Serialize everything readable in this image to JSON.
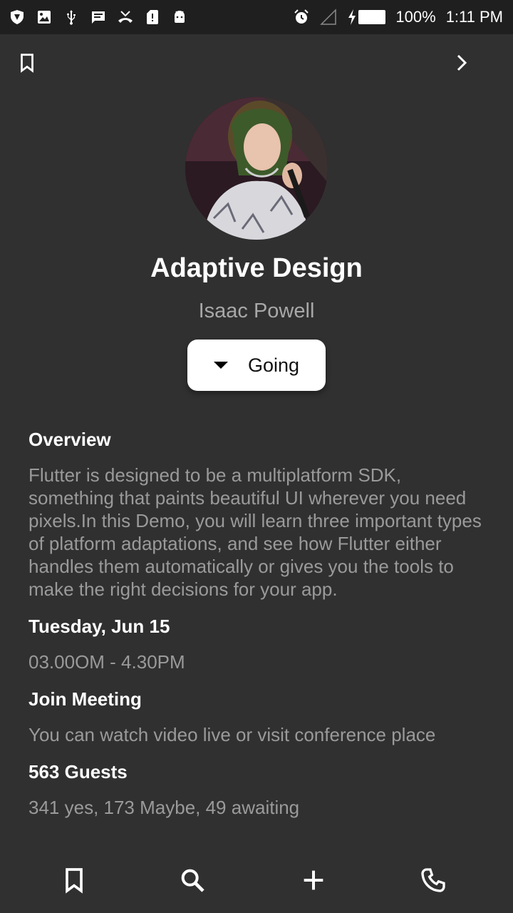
{
  "status_bar": {
    "left_icons": [
      "shield-icon",
      "image-icon",
      "usb-icon",
      "message-icon",
      "missed-call-icon",
      "sim-alert-icon",
      "android-icon"
    ],
    "right_icons": [
      "alarm-icon",
      "signal-icon",
      "charging-icon",
      "battery-icon"
    ],
    "battery": "100%",
    "time": "1:11 PM"
  },
  "app_bar": {
    "left_icon": "bookmark-outline-icon",
    "right_icon": "chevron-right-icon"
  },
  "event": {
    "title": "Adaptive Design",
    "speaker": "Isaac Powell",
    "rsvp_label": "Going",
    "overview_heading": "Overview",
    "overview_text": "Flutter is designed to be a multiplatform SDK, something that paints beautiful UI wherever you need pixels.In this Demo, you will learn three important types of platform adaptations, and see how Flutter either handles them automatically or gives you the tools to make the right decisions for your app.",
    "date_heading": "Tuesday, Jun 15",
    "time_range": "03.00OM - 4.30PM",
    "meeting_heading": "Join Meeting",
    "meeting_text": "You can watch video live or visit conference place",
    "guests_heading": "563 Guests",
    "guests_text": "341 yes, 173 Maybe, 49 awaiting"
  },
  "bottom_nav": [
    "bookmark-icon",
    "search-icon",
    "add-icon",
    "phone-icon"
  ],
  "colors": {
    "background": "#303030",
    "status_bar": "#1f1f1f",
    "primary_text": "#ffffff",
    "secondary_text": "#9a9a9a",
    "button_bg": "#ffffff"
  }
}
